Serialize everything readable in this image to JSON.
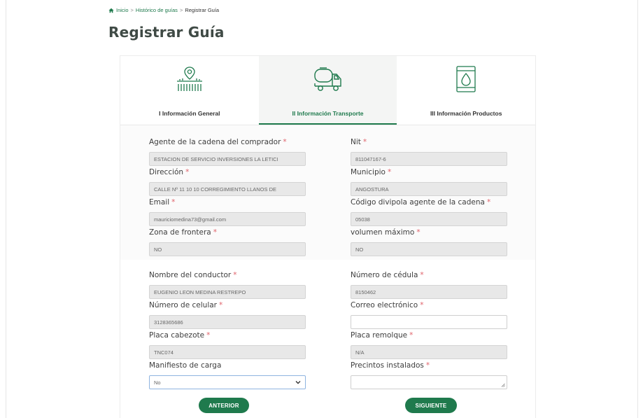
{
  "breadcrumb": {
    "home": "Inicio",
    "history": "Histórico de guías",
    "current": "Registrar Guía",
    "sep": ">"
  },
  "page_title": "Registrar Guía",
  "tabs": [
    {
      "label": "I Información General",
      "icon": "location-grid-icon",
      "active": false
    },
    {
      "label": "II Información Transporte",
      "icon": "tanker-truck-icon",
      "active": true
    },
    {
      "label": "III Información Productos",
      "icon": "oil-barrel-icon",
      "active": false
    }
  ],
  "required_mark": "*",
  "fields": {
    "agente": {
      "label": "Agente de la cadena del comprador",
      "value": "ESTACION DE SERVICIO INVERSIONES LA LETICI"
    },
    "nit": {
      "label": "Nit",
      "value": "811047167-6"
    },
    "direccion": {
      "label": "Dirección",
      "value": "CALLE Nº 11 10 10 CORREGIMIENTO LLANOS DE"
    },
    "municipio": {
      "label": "Municipio",
      "value": "ANGOSTURA"
    },
    "email": {
      "label": "Email",
      "value": "mauriciomedina73@gmail.com"
    },
    "divipola": {
      "label": "Código divipola agente de la cadena",
      "value": "05038"
    },
    "zona": {
      "label": "Zona de frontera",
      "value": "NO"
    },
    "volumen": {
      "label": "volumen máximo",
      "value": "NO"
    },
    "conductor": {
      "label": "Nombre del conductor",
      "value": "EUGENIO LEON MEDINA RESTREPO"
    },
    "cedula": {
      "label": "Número de cédula",
      "value": "8150462"
    },
    "celular": {
      "label": "Número de celular",
      "value": "3128365686"
    },
    "correo": {
      "label": "Correo electrónico",
      "value": ""
    },
    "cabezote": {
      "label": "Placa cabezote",
      "value": "TNC074"
    },
    "remolque": {
      "label": "Placa remolque",
      "value": "N/A"
    },
    "manifiesto": {
      "label": "Manifiesto de carga",
      "value": "No"
    },
    "precintos": {
      "label": "Precintos instalados",
      "value": ""
    }
  },
  "buttons": {
    "prev": "ANTERIOR",
    "next": "SIGUIENTE"
  },
  "colors": {
    "brand": "#1f7a4d",
    "required": "#e0636b"
  }
}
